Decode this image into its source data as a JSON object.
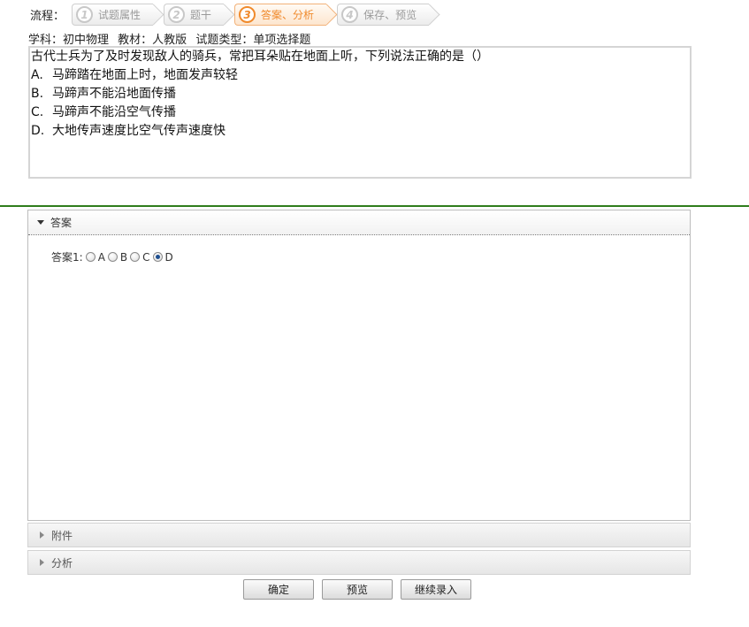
{
  "flow": {
    "label": "流程：",
    "steps": [
      {
        "num": "1",
        "label": "试题属性"
      },
      {
        "num": "2",
        "label": "题干"
      },
      {
        "num": "3",
        "label": "答案、分析"
      },
      {
        "num": "4",
        "label": "保存、预览"
      }
    ],
    "active_step": 3
  },
  "meta": {
    "subject": "学科：初中物理",
    "textbook": "教材：人教版",
    "type": "试题类型：单项选择题"
  },
  "question": {
    "stem": "古代士兵为了及时发现敌人的骑兵，常把耳朵贴在地面上听，下列说法正确的是（）",
    "options": [
      {
        "key": "A.",
        "text": "马蹄踏在地面上时，地面发声较轻"
      },
      {
        "key": "B.",
        "text": "马蹄声不能沿地面传播"
      },
      {
        "key": "C.",
        "text": "马蹄声不能沿空气传播"
      },
      {
        "key": "D.",
        "text": "大地传声速度比空气传声速度快"
      }
    ]
  },
  "answer_panel": {
    "title": "答案",
    "answer_label": "答案1:",
    "choices": [
      "A",
      "B",
      "C",
      "D"
    ],
    "selected": "D"
  },
  "attachment_panel": {
    "title": "附件"
  },
  "analysis_panel": {
    "title": "分析"
  },
  "buttons": {
    "confirm": "确定",
    "preview": "预览",
    "continue": "继续录入"
  },
  "colors": {
    "active_step": "#f08a2c",
    "divider": "#2f7d1c"
  }
}
